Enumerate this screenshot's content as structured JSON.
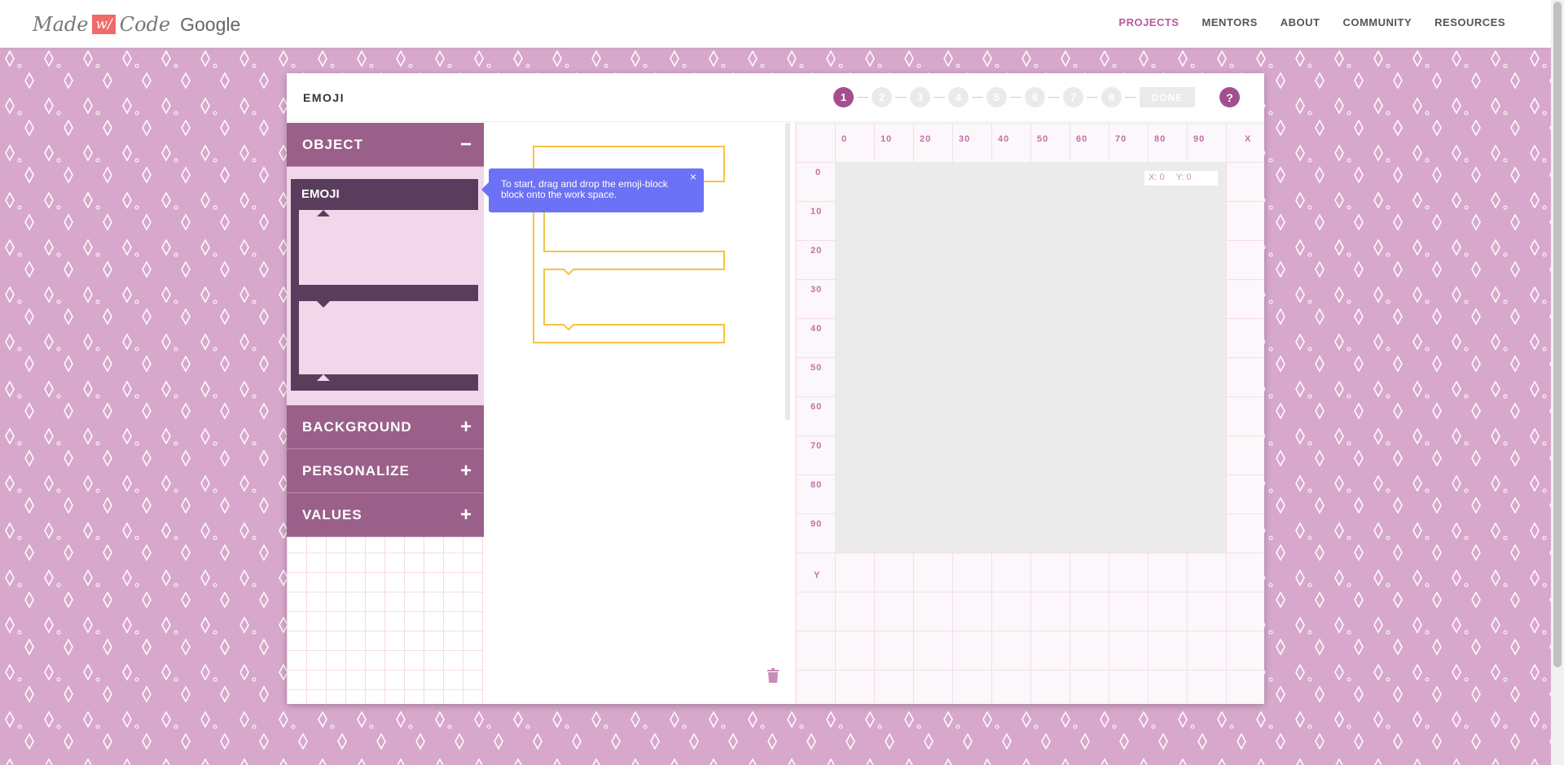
{
  "brand": {
    "made": "Made",
    "w": "w/",
    "code": "Code",
    "google": "Google"
  },
  "nav": [
    "PROJECTS",
    "MENTORS",
    "ABOUT",
    "COMMUNITY",
    "RESOURCES"
  ],
  "project": {
    "title": "EMOJI",
    "steps": [
      "1",
      "2",
      "3",
      "4",
      "5",
      "6",
      "7",
      "8"
    ],
    "done_label": "DONE",
    "help_label": "?"
  },
  "toolbox": {
    "categories": [
      {
        "label": "OBJECT",
        "sign": "−"
      },
      {
        "label": "BACKGROUND",
        "sign": "+"
      },
      {
        "label": "PERSONALIZE",
        "sign": "+"
      },
      {
        "label": "VALUES",
        "sign": "+"
      }
    ],
    "block_label": "EMOJI"
  },
  "tooltip": {
    "text": "To start, drag and drop the emoji-block block onto the work space.",
    "close": "×"
  },
  "grid": {
    "x_ticks": [
      "0",
      "10",
      "20",
      "30",
      "40",
      "50",
      "60",
      "70",
      "80",
      "90"
    ],
    "y_ticks": [
      "0",
      "10",
      "20",
      "30",
      "40",
      "50",
      "60",
      "70",
      "80",
      "90"
    ],
    "x_axis": "X",
    "y_axis": "Y",
    "coords": {
      "x": "X: 0",
      "y": "Y: 0"
    }
  },
  "colors": {
    "accent": "#a34f8f",
    "category": "#9a6089",
    "block": "#5a3d5c",
    "tooltip": "#6c72f5",
    "outline": "#f5c242"
  }
}
